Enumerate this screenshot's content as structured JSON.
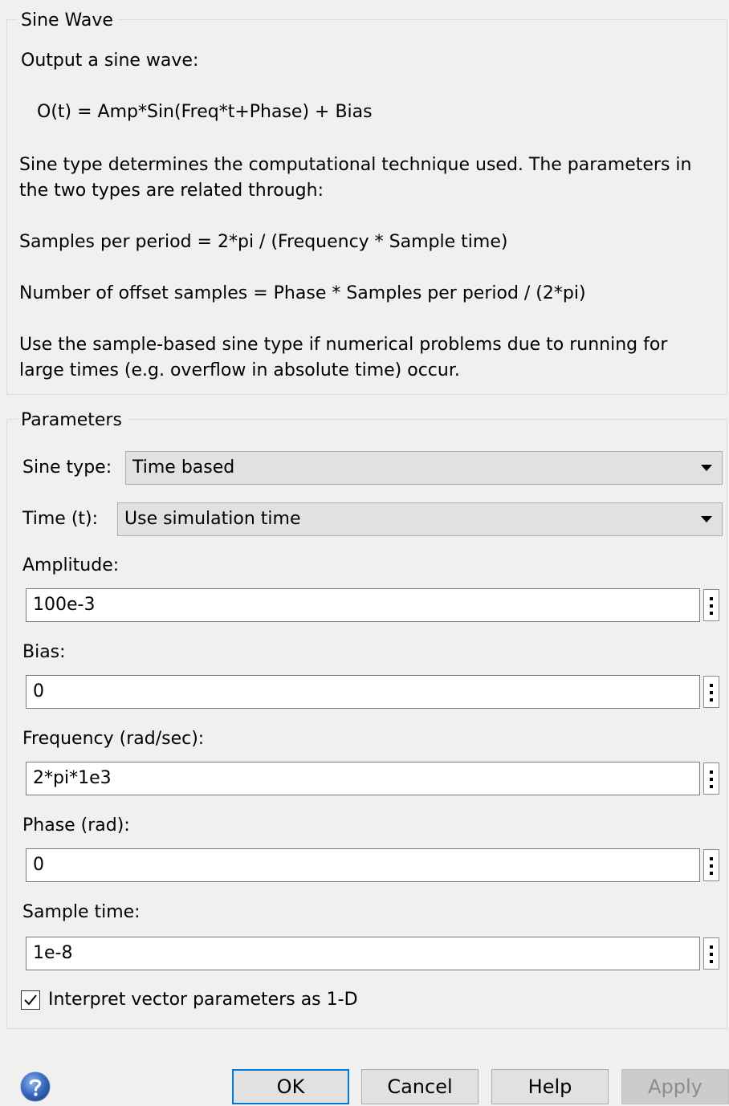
{
  "description_group": {
    "title": "Sine Wave",
    "lines": [
      "Output a sine wave:",
      "O(t) = Amp*Sin(Freq*t+Phase) + Bias",
      "Sine type determines the computational technique used. The parameters in",
      "the two types are related through:",
      "Samples per period = 2*pi / (Frequency * Sample time)",
      "Number of offset samples = Phase * Samples per period / (2*pi)",
      "Use the sample-based sine type if numerical problems due to running for",
      "large times (e.g. overflow in absolute time) occur."
    ]
  },
  "parameters": {
    "title": "Parameters",
    "sine_type": {
      "label": "Sine type:",
      "value": "Time based"
    },
    "time": {
      "label": "Time (t):",
      "value": "Use simulation time"
    },
    "fields": [
      {
        "label": "Amplitude:",
        "value": "100e-3"
      },
      {
        "label": "Bias:",
        "value": "0"
      },
      {
        "label": "Frequency (rad/sec):",
        "value": "2*pi*1e3"
      },
      {
        "label": "Phase (rad):",
        "value": "0"
      },
      {
        "label": "Sample time:",
        "value": "1e-8"
      }
    ],
    "interpret_vector": {
      "label": "Interpret vector parameters as 1-D",
      "checked": true
    }
  },
  "buttons": {
    "ok": "OK",
    "cancel": "Cancel",
    "help": "Help",
    "apply": "Apply"
  },
  "icons": {
    "help": "help-circle-icon",
    "checkbox": "checkmark-icon",
    "dropdown": "chevron-down-icon",
    "kebab": "more-vertical-icon"
  },
  "colors": {
    "background": "#f0f0f0",
    "ok_border": "#0078d7",
    "help_icon": "#2f63b8"
  }
}
